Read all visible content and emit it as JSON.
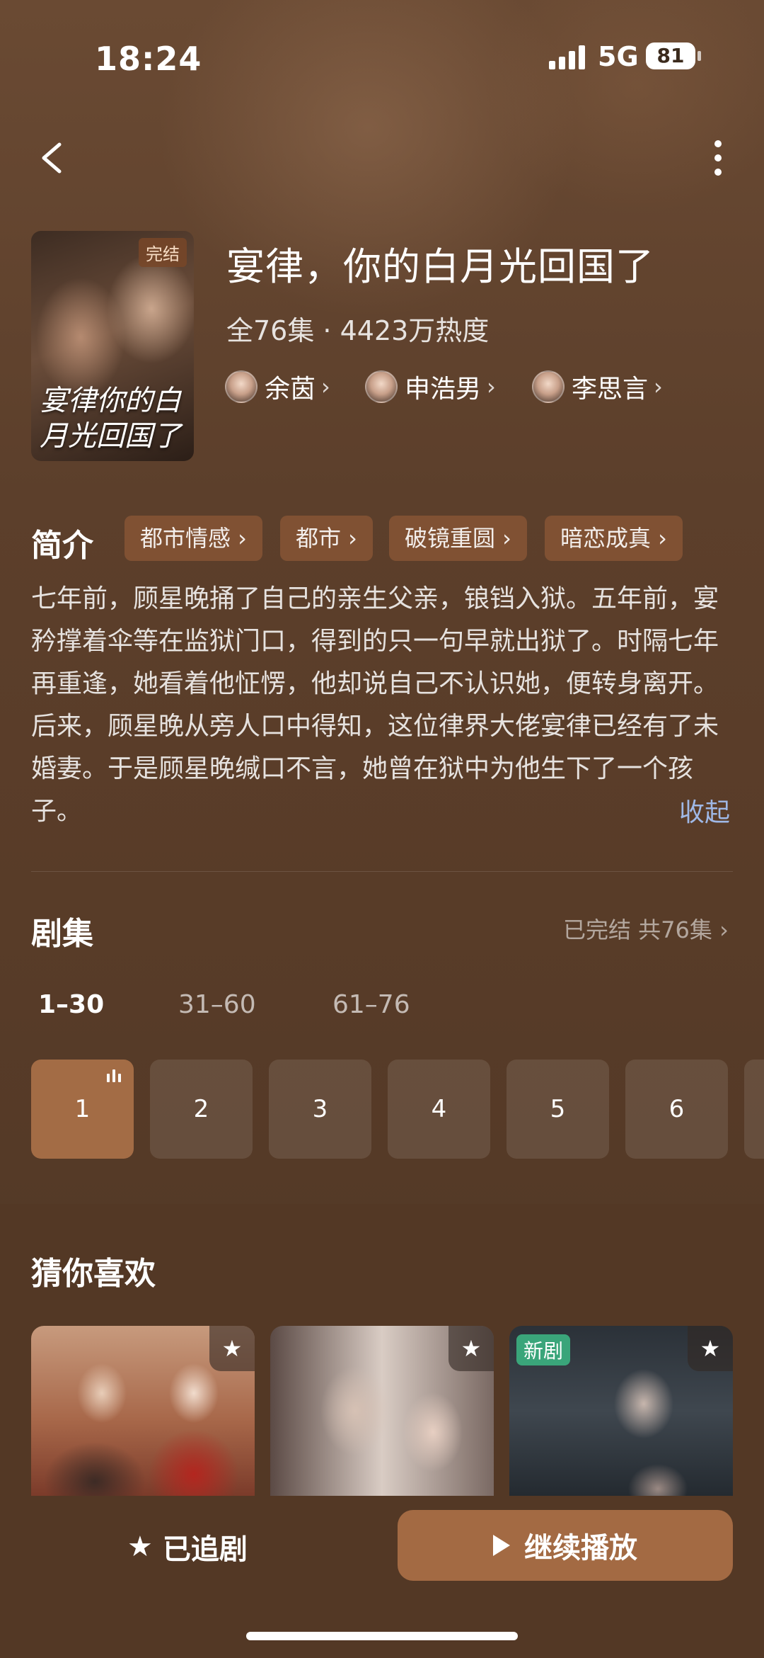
{
  "status_bar": {
    "time": "18:24",
    "network": "5G",
    "battery": "81"
  },
  "drama": {
    "poster_badge": "完结",
    "poster_title": "宴律你的白月光回国了",
    "title": "宴律，你的白月光回国了",
    "meta": "全76集 · 4423万热度",
    "cast": [
      {
        "name": "余茵",
        "chevron": "›"
      },
      {
        "name": "申浩男",
        "chevron": "›"
      },
      {
        "name": "李思言",
        "chevron": "›"
      }
    ]
  },
  "intro": {
    "label": "简介",
    "tags": [
      "都市情感 ›",
      "都市 ›",
      "破镜重圆 ›",
      "暗恋成真 ›"
    ],
    "synopsis": "七年前，顾星晚捅了自己的亲生父亲，锒铛入狱。五年前，宴矜撑着伞等在监狱门口，得到的只一句早就出狱了。时隔七年再重逢，她看着他怔愣，他却说自己不认识她，便转身离开。后来，顾星晚从旁人口中得知，这位律界大佬宴律已经有了未婚妻。于是顾星晚缄口不言，她曾在狱中为他生下了一个孩子。",
    "collapse_label": "收起"
  },
  "episodes": {
    "label": "剧集",
    "status": "已完结 共76集 ›",
    "ranges": [
      "1–30",
      "31–60",
      "61–76"
    ],
    "active_range": "1–30",
    "cells": [
      "1",
      "2",
      "3",
      "4",
      "5",
      "6"
    ],
    "current_episode": "1"
  },
  "recommend": {
    "label": "猜你喜欢",
    "cards": [
      {
        "badge": "",
        "star": "★"
      },
      {
        "badge": "",
        "star": "★"
      },
      {
        "badge": "新剧",
        "star": "★"
      }
    ]
  },
  "bottom_bar": {
    "follow_icon": "★",
    "follow_label": "已追剧",
    "play_label": "继续播放"
  },
  "colors": {
    "accent": "#a36a43",
    "link": "#9fb8e6",
    "new_badge": "#3aa57a"
  },
  "icons": [
    "back-arrow-icon",
    "more-vertical-icon",
    "chevron-right-icon",
    "star-icon",
    "play-icon",
    "playing-bars-icon"
  ]
}
